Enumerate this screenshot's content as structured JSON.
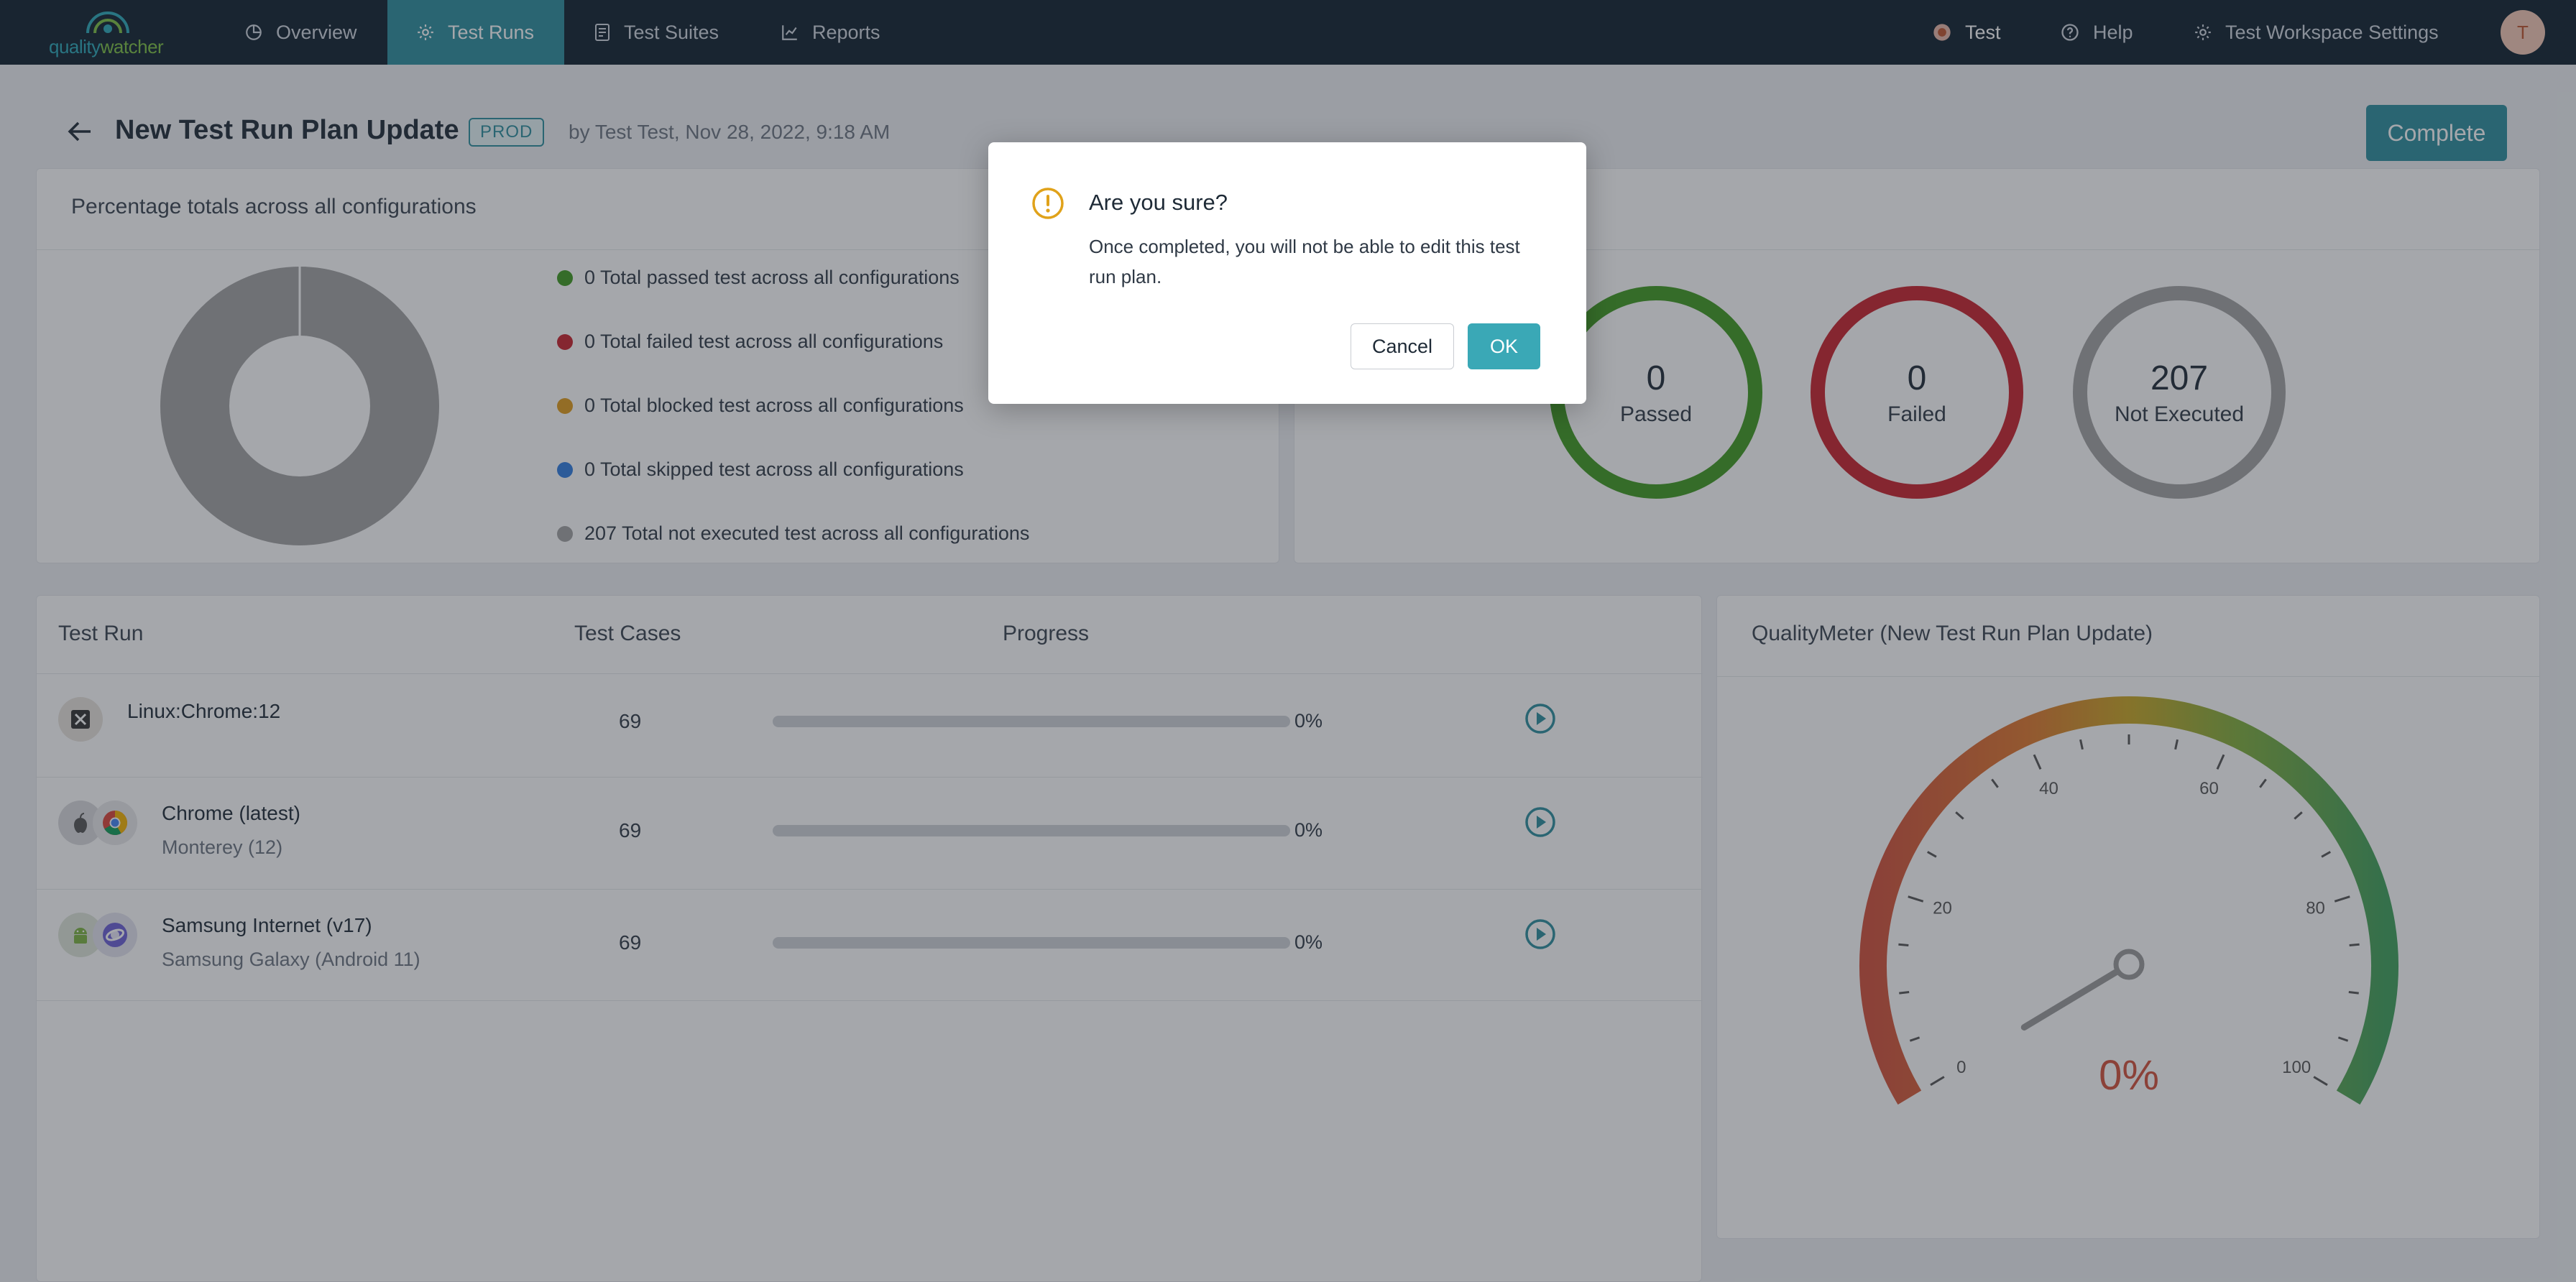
{
  "nav": {
    "logo_quality": "quality",
    "logo_watcher": "watcher",
    "items": [
      {
        "label": "Overview",
        "icon": "pie-chart-icon"
      },
      {
        "label": "Test Runs",
        "icon": "gear-icon",
        "active": true
      },
      {
        "label": "Test Suites",
        "icon": "document-icon"
      },
      {
        "label": "Reports",
        "icon": "line-chart-icon"
      }
    ],
    "right": {
      "workspace": "Test",
      "help": "Help",
      "settings": "Test Workspace Settings",
      "avatar_initial": "T"
    }
  },
  "header": {
    "title": "New Test Run Plan Update",
    "badge": "PROD",
    "author": "by Test Test, Nov 28, 2022, 9:18 AM",
    "complete_label": "Complete"
  },
  "percentage_card": {
    "title": "Percentage totals across all configurations",
    "legend": [
      {
        "text": "0 Total passed test across all configurations",
        "color": "#3f9a1f"
      },
      {
        "text": "0 Total failed test across all configurations",
        "color": "#c8212c"
      },
      {
        "text": "0 Total blocked test across all configurations",
        "color": "#e09b1a"
      },
      {
        "text": "0 Total skipped test across all configurations",
        "color": "#2f7de0"
      },
      {
        "text": "207 Total not executed test across all configurations",
        "color": "#a3a3a3"
      }
    ]
  },
  "status_rings": [
    {
      "value": "0",
      "label": "Passed",
      "color": "#3f9a1f"
    },
    {
      "value": "0",
      "label": "Failed",
      "color": "#c8212c"
    },
    {
      "value": "207",
      "label": "Not Executed",
      "color": "#a3a3a3"
    }
  ],
  "table": {
    "headers": {
      "run": "Test Run",
      "cases": "Test Cases",
      "progress": "Progress"
    },
    "rows": [
      {
        "name": "Linux:Chrome:12",
        "sub": "",
        "cases": "69",
        "progress_pct": 0,
        "pct_label": "0%"
      },
      {
        "name": "Chrome (latest)",
        "sub": "Monterey (12)",
        "cases": "69",
        "progress_pct": 0,
        "pct_label": "0%"
      },
      {
        "name": "Samsung Internet (v17)",
        "sub": "Samsung Galaxy (Android 11)",
        "cases": "69",
        "progress_pct": 0,
        "pct_label": "0%"
      }
    ]
  },
  "quality_meter": {
    "title": "QualityMeter (New Test Run Plan Update)",
    "ticks": [
      "0",
      "20",
      "40",
      "60",
      "80",
      "100"
    ],
    "value": 0,
    "value_label": "0%"
  },
  "modal": {
    "title": "Are you sure?",
    "text": "Once completed, you will not be able to edit this test run plan.",
    "cancel_label": "Cancel",
    "ok_label": "OK"
  }
}
